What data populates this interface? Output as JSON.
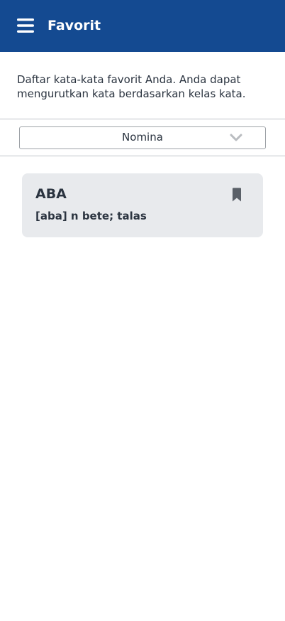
{
  "header": {
    "title": "Favorit",
    "menu_icon": "hamburger-menu-icon",
    "background_color": "#144a91",
    "text_color": "#ffffff"
  },
  "intro": {
    "text": "Daftar kata-kata favorit Anda. Anda dapat mengurutkan kata berdasarkan kelas kata."
  },
  "filter": {
    "selected": "Nomina",
    "chevron_icon": "chevron-down-icon"
  },
  "favorites": [
    {
      "word": "ABA",
      "definition": "[aba] n bete; talas",
      "bookmark_icon": "bookmark-icon",
      "bookmarked": true
    }
  ],
  "colors": {
    "card_background": "#e8eaed",
    "text": "#2b3440",
    "bookmark": "#5a6068"
  }
}
